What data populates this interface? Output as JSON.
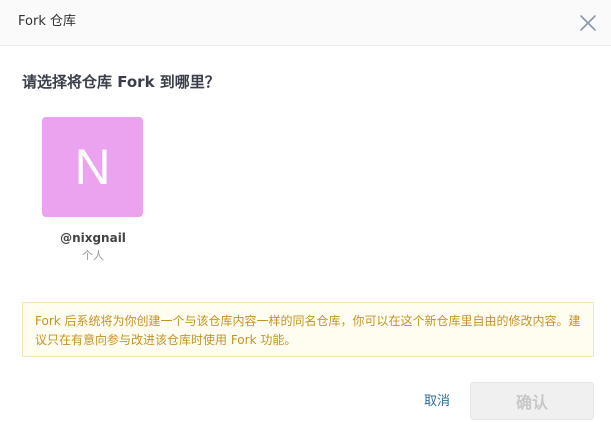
{
  "dialog": {
    "title": "Fork 仓库",
    "question": "请选择将仓库 Fork 到哪里？"
  },
  "accounts": [
    {
      "avatar_letter": "N",
      "name": "@nixgnail",
      "type": "个人",
      "avatar_color": "#eba2ef"
    }
  ],
  "notice": {
    "text": "Fork 后系统将为你创建一个与该仓库内容一样的同名仓库，你可以在这个新仓库里自由的修改内容。建议只在有意向参与改进该仓库时使用 Fork 功能。",
    "color": "#c49328"
  },
  "buttons": {
    "cancel_label": "取消",
    "confirm_label": "确认",
    "cancel_color": "#2f6d9a"
  },
  "icons": {
    "close": "close-icon"
  }
}
